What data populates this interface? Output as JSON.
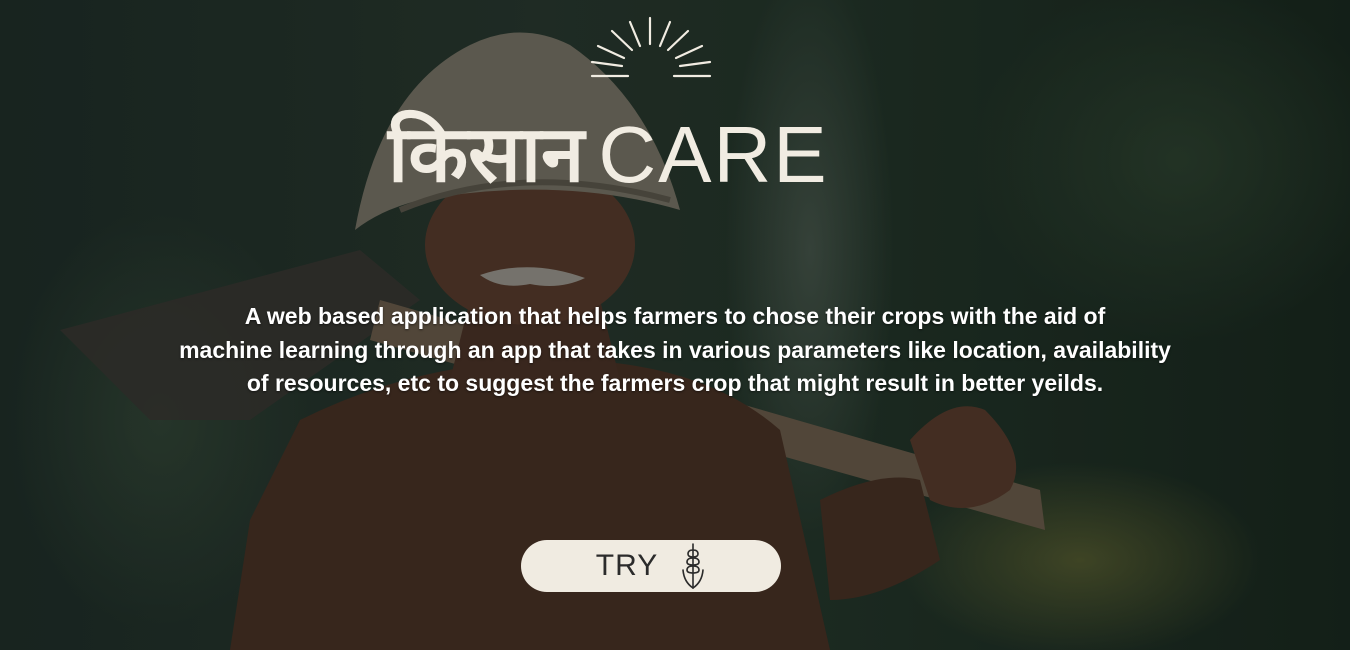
{
  "brand": {
    "title_hindi": "किसान",
    "title_english": "CARE"
  },
  "description": {
    "lines": [
      "A web based application that helps farmers to chose their crops with the aid of",
      "machine learning through an app that takes in various parameters like location, availability",
      "of resources, etc to suggest the farmers crop that might result in better yeilds."
    ]
  },
  "cta": {
    "label": "TRY",
    "icon": "wheat-icon"
  },
  "colors": {
    "title": "#f1ece2",
    "button_bg": "#f0ebe1",
    "button_text": "#2b2b2b"
  }
}
